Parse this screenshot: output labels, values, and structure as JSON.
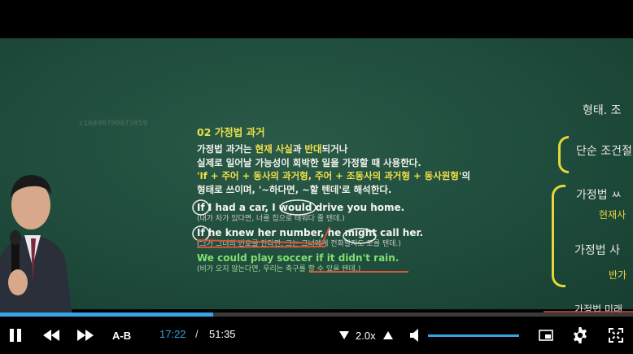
{
  "player": {
    "current_time": "17:22",
    "separator": "/",
    "duration": "51:35",
    "ab_label": "A-B",
    "speed_label": "2.0x",
    "progress": 0.337,
    "volume": 1.0,
    "accent_color": "#38a3e8"
  },
  "video": {
    "watermark": "c16890700073059",
    "lecture": {
      "title": "02 가정법 과거",
      "lines": [
        [
          {
            "t": "가정법 과거는 ",
            "c": "w"
          },
          {
            "t": "현재 사실",
            "c": "y"
          },
          {
            "t": "과 ",
            "c": "w"
          },
          {
            "t": "반대",
            "c": "y"
          },
          {
            "t": "되거나",
            "c": "w"
          }
        ],
        [
          {
            "t": "실제로 일어날 가능성이 회박한 일을 가정할 때 사용한다.",
            "c": "w"
          }
        ],
        [
          {
            "t": "'If + 주어 + 동사의 과거형, 주어 + 조동사의 과거형 + 동사원형'",
            "c": "y"
          },
          {
            "t": "의",
            "c": "w"
          }
        ],
        [
          {
            "t": "형태로 쓰이며, '~하다면, ~할 텐데'로 해석한다.",
            "c": "w"
          }
        ]
      ],
      "examples": [
        {
          "en": "If I had a car, I would drive you home.",
          "kr": "(내가 차가 있다면, 너를 집으로 태워다 줄 텐데.)",
          "green": false
        },
        {
          "en": "If he knew her number, he might call her.",
          "kr": "(그가 그녀의 번호를 안다면, 그는 그녀에게 전화할지도 모를 텐데.)",
          "green": false
        },
        {
          "en": "We could play soccer if it didn't rain.",
          "kr": "(비가 오지 않는다면, 우리는 축구를 할 수 있을 텐데.)",
          "green": true
        }
      ]
    },
    "board_notes": [
      {
        "text": "형태. 조"
      },
      {
        "text": "단순 조건절"
      },
      {
        "text": "가정법 ㅆ"
      },
      {
        "text": "현재사"
      },
      {
        "text": "가정법 사"
      },
      {
        "text": "반가"
      },
      {
        "text": "가정법 미래"
      }
    ]
  }
}
